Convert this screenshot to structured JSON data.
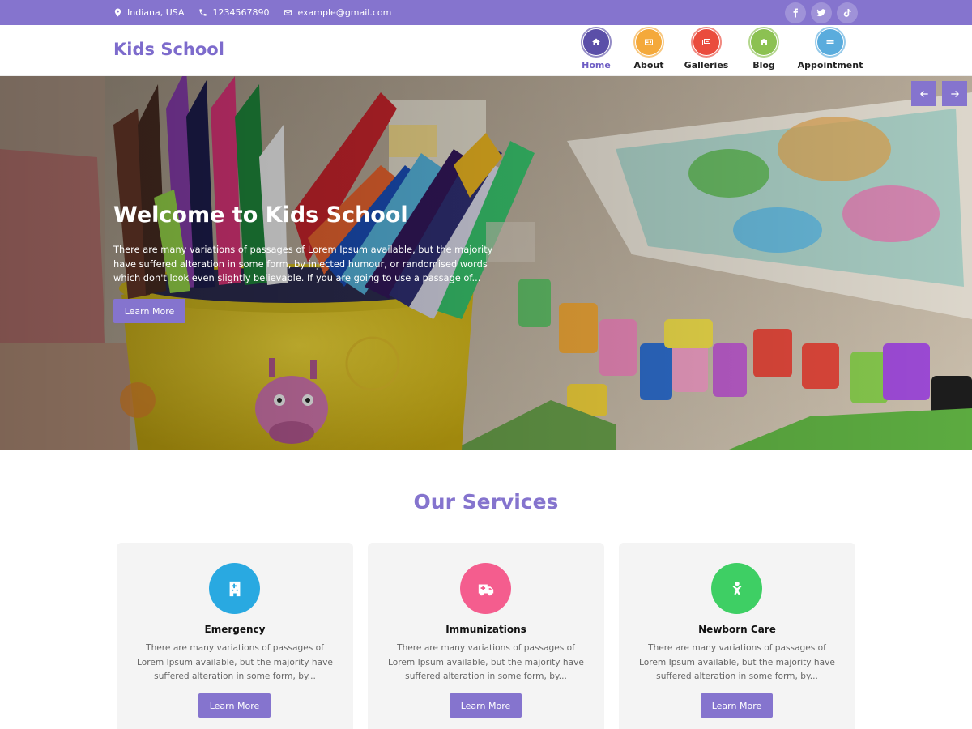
{
  "topbar": {
    "location": "Indiana, USA",
    "phone": "1234567890",
    "email": "example@gmail.com",
    "social": [
      "facebook-icon",
      "twitter-icon",
      "tiktok-icon"
    ]
  },
  "header": {
    "logo": "Kids School",
    "nav": [
      {
        "label": "Home",
        "icon": "home-icon",
        "color": "#5b4fa8",
        "active": true
      },
      {
        "label": "About",
        "icon": "id-card-icon",
        "color": "#f4a93b"
      },
      {
        "label": "Galleries",
        "icon": "gallery-icon",
        "color": "#ea4c3d"
      },
      {
        "label": "Blog",
        "icon": "blog-icon",
        "color": "#8cc152"
      },
      {
        "label": "Appointment",
        "icon": "appointment-icon",
        "color": "#5aacdd"
      }
    ]
  },
  "hero": {
    "title": "Welcome to Kids School",
    "text": "There are many variations of passages of Lorem Ipsum available, but the majority have suffered alteration in some form, by injected humour, or randomised words which don't look even slightly believable. If you are going to use a passage of...",
    "button": "Learn More"
  },
  "services": {
    "title": "Our Services",
    "cards": [
      {
        "title": "Emergency",
        "icon": "hospital-icon",
        "color": "#29a9e1",
        "text": "There are many variations of passages of Lorem Ipsum available, but the majority have suffered alteration in some form, by...",
        "button": "Learn More"
      },
      {
        "title": "Immunizations",
        "icon": "ambulance-icon",
        "color": "#f45d8e",
        "text": "There are many variations of passages of Lorem Ipsum available, but the majority have suffered alteration in some form, by...",
        "button": "Learn More"
      },
      {
        "title": "Newborn Care",
        "icon": "baby-icon",
        "color": "#3ecf64",
        "text": "There are many variations of passages of Lorem Ipsum available, but the majority have suffered alteration in some form, by...",
        "button": "Learn More"
      }
    ]
  }
}
